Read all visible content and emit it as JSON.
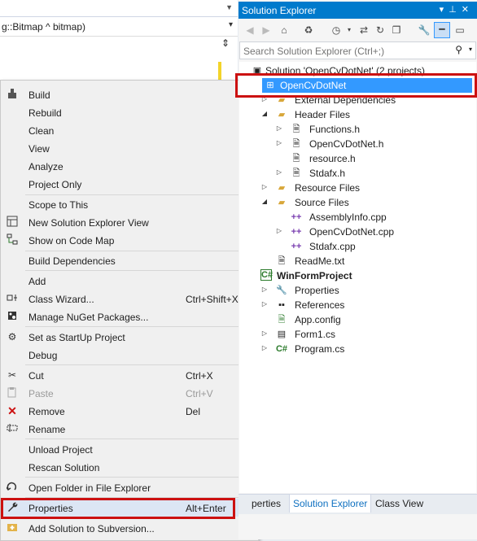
{
  "editor": {
    "signature": "g::Bitmap ^ bitmap)"
  },
  "context_menu": {
    "items": [
      {
        "label": "Build",
        "shortcut": "",
        "icon": "build-icon"
      },
      {
        "label": "Rebuild",
        "shortcut": ""
      },
      {
        "label": "Clean",
        "shortcut": ""
      },
      {
        "label": "View",
        "shortcut": ""
      },
      {
        "label": "Analyze",
        "shortcut": ""
      },
      {
        "label": "Project Only",
        "shortcut": ""
      },
      {
        "label": "Scope to This",
        "shortcut": ""
      },
      {
        "label": "New Solution Explorer View",
        "shortcut": "",
        "icon": "new-view-icon"
      },
      {
        "label": "Show on Code Map",
        "shortcut": "",
        "icon": "code-map-icon"
      },
      {
        "label": "Build Dependencies",
        "shortcut": ""
      },
      {
        "label": "Add",
        "shortcut": ""
      },
      {
        "label": "Class Wizard...",
        "shortcut": "Ctrl+Shift+X",
        "icon": "class-wizard-icon"
      },
      {
        "label": "Manage NuGet Packages...",
        "shortcut": "",
        "icon": "nuget-icon"
      },
      {
        "label": "Set as StartUp Project",
        "shortcut": "",
        "icon": "gear-icon"
      },
      {
        "label": "Debug",
        "shortcut": ""
      },
      {
        "label": "Cut",
        "shortcut": "Ctrl+X",
        "icon": "scissors-icon"
      },
      {
        "label": "Paste",
        "shortcut": "Ctrl+V",
        "icon": "paste-icon"
      },
      {
        "label": "Remove",
        "shortcut": "Del",
        "icon": "remove-icon"
      },
      {
        "label": "Rename",
        "shortcut": "",
        "icon": "rename-icon"
      },
      {
        "label": "Unload Project",
        "shortcut": ""
      },
      {
        "label": "Rescan Solution",
        "shortcut": ""
      },
      {
        "label": "Open Folder in File Explorer",
        "shortcut": "",
        "icon": "open-folder-icon"
      },
      {
        "label": "Properties",
        "shortcut": "Alt+Enter",
        "icon": "wrench-icon"
      },
      {
        "label": "Add Solution to Subversion...",
        "shortcut": "",
        "icon": "subversion-icon"
      }
    ]
  },
  "solution_explorer": {
    "title": "Solution Explorer",
    "search_placeholder": "Search Solution Explorer (Ctrl+;)",
    "tree": [
      {
        "label": "Solution 'OpenCvDotNet' (2 projects)"
      },
      {
        "label": "OpenCvDotNet"
      },
      {
        "label": "External Dependencies"
      },
      {
        "label": "Header Files"
      },
      {
        "label": "Functions.h"
      },
      {
        "label": "OpenCvDotNet.h"
      },
      {
        "label": "resource.h"
      },
      {
        "label": "Stdafx.h"
      },
      {
        "label": "Resource Files"
      },
      {
        "label": "Source Files"
      },
      {
        "label": "AssemblyInfo.cpp"
      },
      {
        "label": "OpenCvDotNet.cpp"
      },
      {
        "label": "Stdafx.cpp"
      },
      {
        "label": "ReadMe.txt"
      },
      {
        "label": "WinFormProject"
      },
      {
        "label": "Properties"
      },
      {
        "label": "References"
      },
      {
        "label": "App.config"
      },
      {
        "label": "Form1.cs"
      },
      {
        "label": "Program.cs"
      }
    ],
    "tabs": [
      "perties",
      "Solution Explorer",
      "Class View"
    ]
  }
}
